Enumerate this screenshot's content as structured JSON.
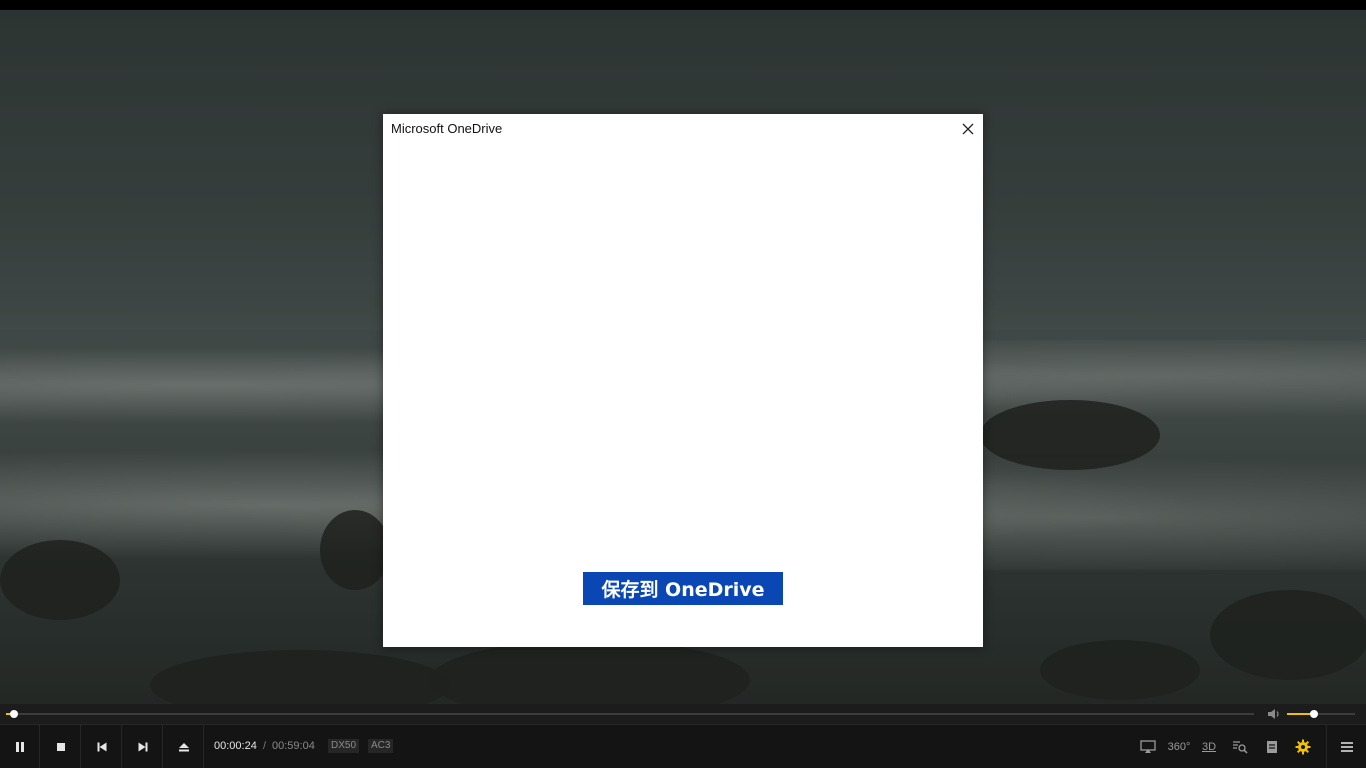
{
  "dialog": {
    "title": "Microsoft OneDrive",
    "save_button_label": "保存到 OneDrive",
    "accent": "#0a47b5"
  },
  "player": {
    "accent": "#f2c200",
    "progress_fraction": 0.0068,
    "volume_fraction": 0.4,
    "time_current": "00:00:24",
    "time_separator": "/",
    "time_total": "00:59:04",
    "video_codec": "DX50",
    "audio_codec": "AC3",
    "controls_left": [
      "pause-icon",
      "stop-icon",
      "previous-icon",
      "next-icon",
      "eject-icon"
    ],
    "controls_right": [
      "screen-cast-icon",
      "360-icon",
      "3d-icon",
      "playlist-search-icon",
      "subtitle-icon",
      "settings-gear-icon",
      "menu-icon"
    ],
    "label_360": "360°",
    "label_3d": "3D"
  }
}
